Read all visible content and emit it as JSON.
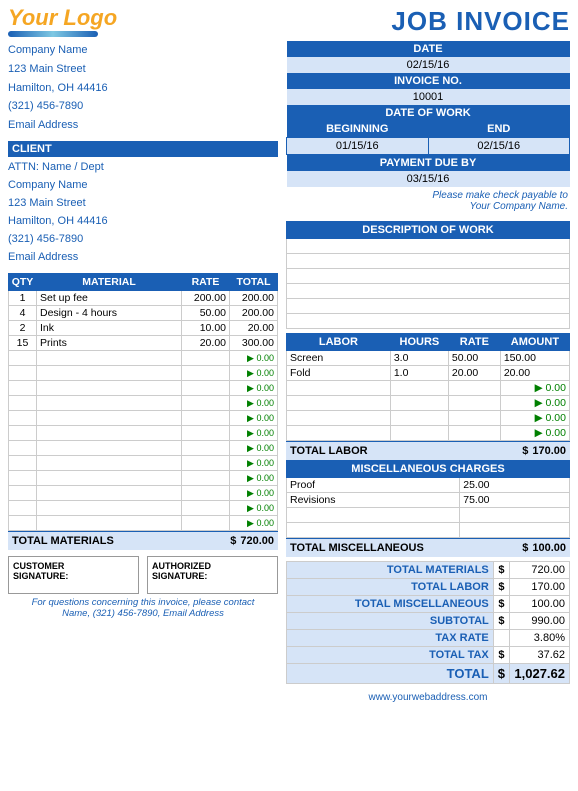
{
  "logo": {
    "text": "Your Logo",
    "underline": true
  },
  "header": {
    "title": "JOB INVOICE"
  },
  "company": {
    "name": "Company Name",
    "address": "123 Main Street",
    "city": "Hamilton, OH  44416",
    "phone": "(321) 456-7890",
    "email": "Email Address"
  },
  "date_block": {
    "date_label": "DATE",
    "date_value": "02/15/16",
    "invoice_label": "INVOICE NO.",
    "invoice_value": "10001",
    "date_of_work_label": "DATE OF WORK",
    "beginning_label": "BEGINNING",
    "end_label": "END",
    "beginning_value": "01/15/16",
    "end_value": "02/15/16",
    "payment_due_label": "PAYMENT DUE BY",
    "payment_due_value": "03/15/16",
    "payable_note_line1": "Please make check payable to",
    "payable_note_line2": "Your Company Name."
  },
  "client": {
    "header": "CLIENT",
    "attn": "ATTN: Name / Dept",
    "name": "Company Name",
    "address": "123 Main Street",
    "city": "Hamilton, OH  44416",
    "phone": "(321) 456-7890",
    "email": "Email Address"
  },
  "materials_table": {
    "headers": [
      "QTY",
      "MATERIAL",
      "RATE",
      "TOTAL"
    ],
    "rows": [
      {
        "qty": "1",
        "material": "Set up fee",
        "rate": "200.00",
        "total": "200.00"
      },
      {
        "qty": "4",
        "material": "Design - 4 hours",
        "rate": "50.00",
        "total": "200.00"
      },
      {
        "qty": "2",
        "material": "Ink",
        "rate": "10.00",
        "total": "20.00"
      },
      {
        "qty": "15",
        "material": "Prints",
        "rate": "20.00",
        "total": "300.00"
      },
      {
        "qty": "",
        "material": "",
        "rate": "",
        "total": "0.00"
      },
      {
        "qty": "",
        "material": "",
        "rate": "",
        "total": "0.00"
      },
      {
        "qty": "",
        "material": "",
        "rate": "",
        "total": "0.00"
      },
      {
        "qty": "",
        "material": "",
        "rate": "",
        "total": "0.00"
      },
      {
        "qty": "",
        "material": "",
        "rate": "",
        "total": "0.00"
      },
      {
        "qty": "",
        "material": "",
        "rate": "",
        "total": "0.00"
      },
      {
        "qty": "",
        "material": "",
        "rate": "",
        "total": "0.00"
      },
      {
        "qty": "",
        "material": "",
        "rate": "",
        "total": "0.00"
      },
      {
        "qty": "",
        "material": "",
        "rate": "",
        "total": "0.00"
      },
      {
        "qty": "",
        "material": "",
        "rate": "",
        "total": "0.00"
      },
      {
        "qty": "",
        "material": "",
        "rate": "",
        "total": "0.00"
      },
      {
        "qty": "",
        "material": "",
        "rate": "",
        "total": "0.00"
      }
    ],
    "total_label": "TOTAL MATERIALS",
    "total_dollar": "$",
    "total_value": "720.00"
  },
  "description_table": {
    "header": "DESCRIPTION OF WORK",
    "rows": [
      "",
      "",
      "",
      "",
      "",
      ""
    ]
  },
  "labor_table": {
    "headers": [
      "LABOR",
      "HOURS",
      "RATE",
      "AMOUNT"
    ],
    "rows": [
      {
        "labor": "Screen",
        "hours": "3.0",
        "rate": "50.00",
        "amount": "150.00"
      },
      {
        "labor": "Fold",
        "hours": "1.0",
        "rate": "20.00",
        "amount": "20.00"
      },
      {
        "labor": "",
        "hours": "",
        "rate": "",
        "amount": "0.00"
      },
      {
        "labor": "",
        "hours": "",
        "rate": "",
        "amount": "0.00"
      },
      {
        "labor": "",
        "hours": "",
        "rate": "",
        "amount": "0.00"
      },
      {
        "labor": "",
        "hours": "",
        "rate": "",
        "amount": "0.00"
      }
    ],
    "total_label": "TOTAL LABOR",
    "total_dollar": "$",
    "total_value": "170.00"
  },
  "misc_table": {
    "header": "MISCELLANEOUS CHARGES",
    "rows": [
      {
        "desc": "Proof",
        "amount": "25.00"
      },
      {
        "desc": "Revisions",
        "amount": "75.00"
      },
      {
        "desc": "",
        "amount": ""
      },
      {
        "desc": "",
        "amount": ""
      }
    ],
    "total_label": "TOTAL MISCELLANEOUS",
    "total_dollar": "$",
    "total_value": "100.00"
  },
  "summary": {
    "total_materials_label": "TOTAL MATERIALS",
    "total_materials_dollar": "$",
    "total_materials_value": "720.00",
    "total_labor_label": "TOTAL LABOR",
    "total_labor_dollar": "$",
    "total_labor_value": "170.00",
    "total_misc_label": "TOTAL MISCELLANEOUS",
    "total_misc_dollar": "$",
    "total_misc_value": "100.00",
    "subtotal_label": "SUBTOTAL",
    "subtotal_dollar": "$",
    "subtotal_value": "990.00",
    "tax_rate_label": "TAX RATE",
    "tax_rate_value": "3.80%",
    "total_tax_label": "TOTAL TAX",
    "total_tax_dollar": "$",
    "total_tax_value": "37.62",
    "total_label": "TOTAL",
    "total_dollar": "$",
    "total_value": "1,027.62"
  },
  "signatures": {
    "customer_label": "CUSTOMER",
    "customer_sub": "SIGNATURE:",
    "authorized_label": "AUTHORIZED",
    "authorized_sub": "SIGNATURE:"
  },
  "footer": {
    "note": "For questions concerning this invoice, please contact",
    "contact": "Name, (321) 456-7890, Email Address",
    "website": "www.yourwebaddress.com"
  }
}
